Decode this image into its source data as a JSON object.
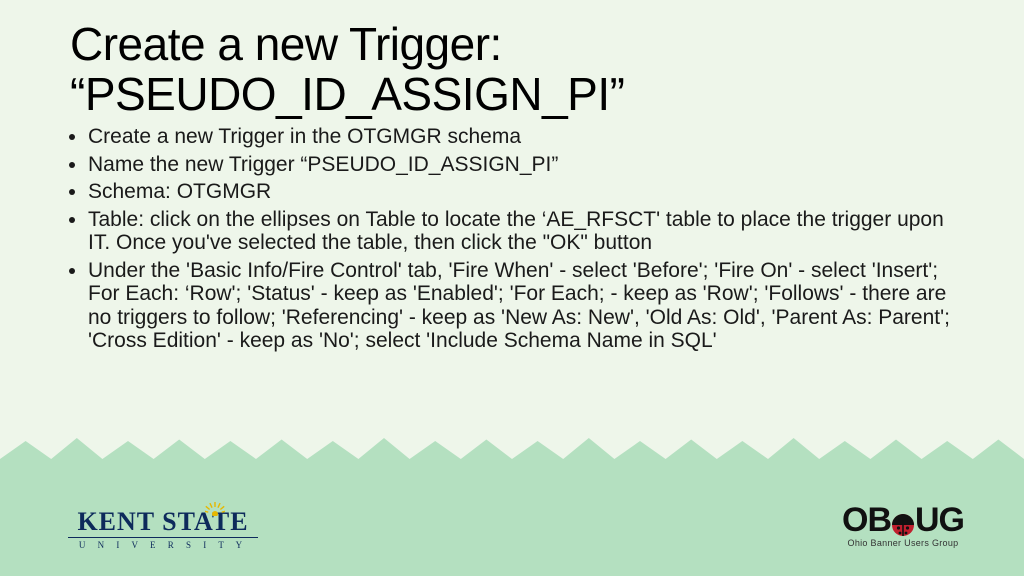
{
  "title_line1": "Create a new Trigger:",
  "title_line2": "“PSEUDO_ID_ASSIGN_PI”",
  "bullets": [
    "Create a new Trigger in the OTGMGR schema",
    "Name the new Trigger “PSEUDO_ID_ASSIGN_PI”",
    "Schema: OTGMGR",
    "Table: click on the ellipses on Table to locate the ‘AE_RFSCT' table to place the trigger upon IT. Once you've selected the table, then click the \"OK\" button",
    "Under the 'Basic Info/Fire Control' tab, 'Fire When' - select 'Before'; 'Fire On' - select 'Insert'; For Each: ‘Row'; 'Status' - keep as 'Enabled'; 'For Each; - keep as 'Row'; 'Follows' - there are no triggers to follow; 'Referencing' - keep as 'New As: New', 'Old As: Old', 'Parent As: Parent'; 'Cross Edition' - keep as 'No'; select 'Include Schema Name in SQL'"
  ],
  "logos": {
    "kent": {
      "main": "KENT STATE",
      "sub": "U N I V E R S I T Y"
    },
    "obug": {
      "letter_o": "O",
      "letters_bug_b": "B",
      "letters_bug_ug": "UG",
      "sub": "Ohio Banner Users Group"
    }
  }
}
